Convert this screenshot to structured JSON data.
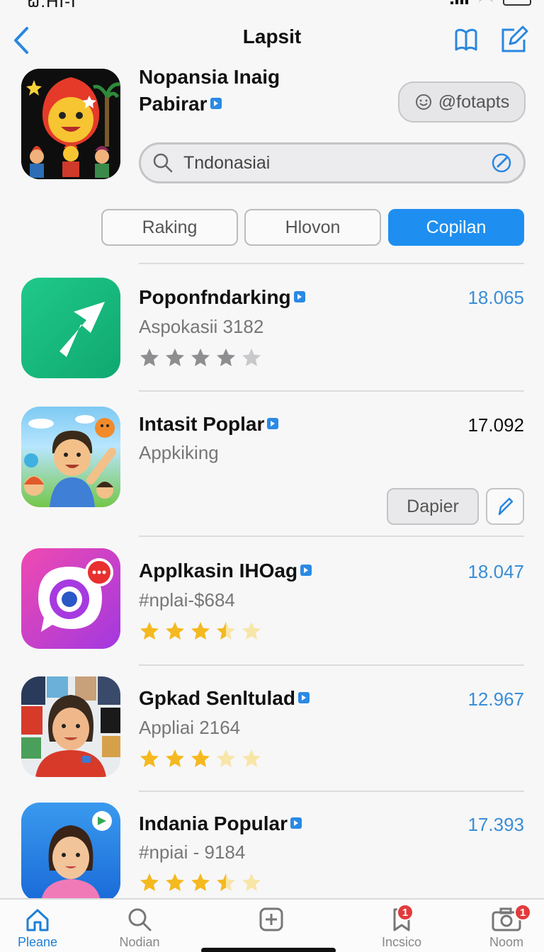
{
  "status": {
    "time": "ຝ.HI-I"
  },
  "header": {
    "title": "Lapsit"
  },
  "profile": {
    "name": "Nopansia Inaig Pabirar",
    "handle": "@fotapts",
    "search_value": "Tndonasiai"
  },
  "segments": [
    {
      "label": "Raking",
      "active": false
    },
    {
      "label": "Hlovon",
      "active": false
    },
    {
      "label": "Copilan",
      "active": true
    }
  ],
  "apps": [
    {
      "name": "Poponfndarking",
      "subtitle": "Aspokasii 3182",
      "number": "18.065",
      "rating": 4,
      "star_color": "gray"
    },
    {
      "name": "Intasit Poplar",
      "subtitle": "Appkiking",
      "number": "17.092",
      "action_label": "Dapier"
    },
    {
      "name": "Applkasin IHOag",
      "subtitle": "#nplai-$684",
      "number": "18.047",
      "rating": 3.5,
      "star_color": "gold"
    },
    {
      "name": "Gpkad Senltulad",
      "subtitle": "Appliai 2164",
      "number": "12.967",
      "rating": 3,
      "star_color": "gold"
    },
    {
      "name": "Indania Popular",
      "subtitle": "#npiai - 9184",
      "number": "17.393",
      "rating": 3.5,
      "star_color": "gold"
    }
  ],
  "tabs": [
    {
      "label": "Pleane",
      "icon": "home-icon",
      "active": true
    },
    {
      "label": "Nodian",
      "icon": "search-icon",
      "active": false
    },
    {
      "label": "",
      "icon": "add-icon",
      "active": false
    },
    {
      "label": "Incsico",
      "icon": "bookmark-icon",
      "active": false,
      "badge": "1"
    },
    {
      "label": "Noom",
      "icon": "camera-icon",
      "active": false,
      "badge": "1"
    }
  ],
  "colors": {
    "accent": "#1e8ff0",
    "link_number": "#3a8ed6",
    "badge": "#e23b3b",
    "star_gold": "#f5b91f",
    "star_gray": "#8e8e90"
  }
}
